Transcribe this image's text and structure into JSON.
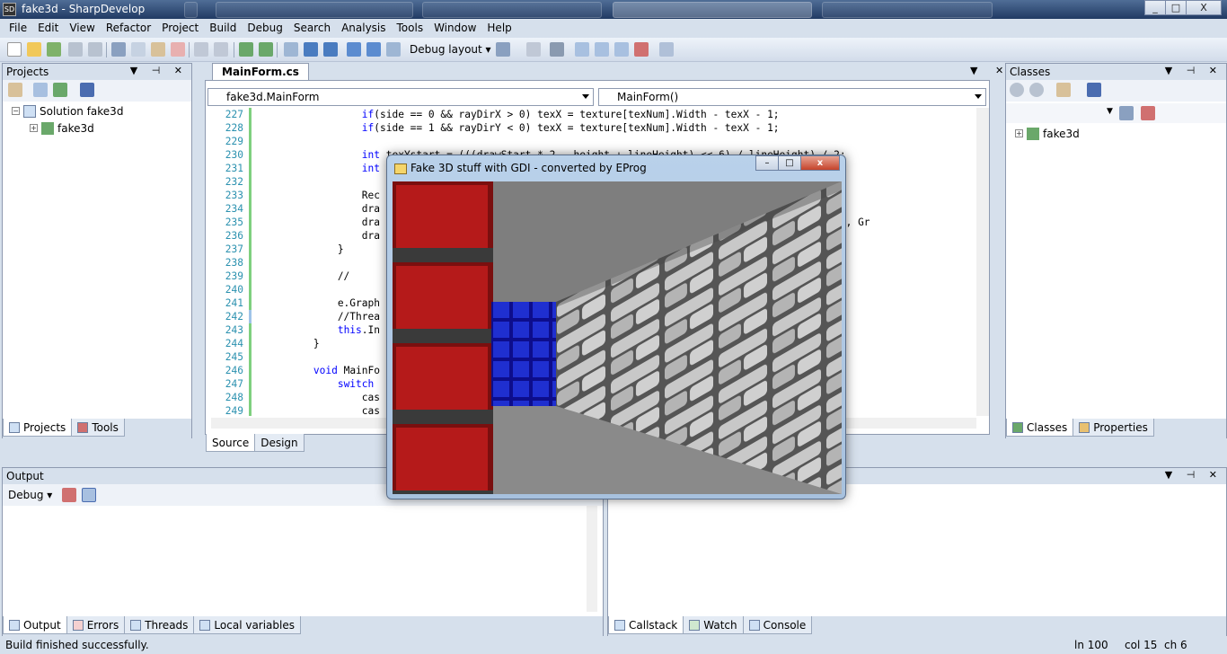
{
  "window": {
    "title": "fake3d - SharpDevelop",
    "controls": [
      "_",
      "□",
      "X"
    ]
  },
  "menu": [
    "File",
    "Edit",
    "View",
    "Refactor",
    "Project",
    "Build",
    "Debug",
    "Search",
    "Analysis",
    "Tools",
    "Window",
    "Help"
  ],
  "toolbar": {
    "layout_dropdown": "Debug layout"
  },
  "projects_pane": {
    "title": "Projects",
    "solution": "Solution fake3d",
    "project": "fake3d",
    "tabs": [
      "Projects",
      "Tools"
    ]
  },
  "editor": {
    "tab": "MainForm.cs",
    "class_combo": "fake3d.MainForm",
    "member_combo": "MainForm()",
    "lines": [
      {
        "n": "227",
        "code": "                if(side == 0 && rayDirX > 0) texX = texture[texNum].Width - texX - 1;"
      },
      {
        "n": "228",
        "code": "                if(side == 1 && rayDirY < 0) texX = texture[texNum].Width - texX - 1;"
      },
      {
        "n": "229",
        "code": ""
      },
      {
        "n": "230",
        "code": "                int texYstart = (((drawStart * 2 - height + lineHeight) << 6) / lineHeight) / 2;"
      },
      {
        "n": "231",
        "code": "                int                                                            neHeight) / 2;"
      },
      {
        "n": "232",
        "code": ""
      },
      {
        "n": "233",
        "code": "                Rec"
      },
      {
        "n": "234",
        "code": "                dra"
      },
      {
        "n": "235",
        "code": "                dra                                                            wStart), cropRect, Gr"
      },
      {
        "n": "236",
        "code": "                dra"
      },
      {
        "n": "237",
        "code": "            }"
      },
      {
        "n": "238",
        "code": ""
      },
      {
        "n": "239",
        "code": "            //"
      },
      {
        "n": "240",
        "code": ""
      },
      {
        "n": "241",
        "code": "            e.Graph"
      },
      {
        "n": "242",
        "code": "            //Threa"
      },
      {
        "n": "243",
        "code": "            this.In"
      },
      {
        "n": "244",
        "code": "        }"
      },
      {
        "n": "245",
        "code": ""
      },
      {
        "n": "246",
        "code": "        void MainFo"
      },
      {
        "n": "247",
        "code": "            switch"
      },
      {
        "n": "248",
        "code": "                cas"
      },
      {
        "n": "249",
        "code": "                cas"
      }
    ],
    "bottom_tabs": [
      "Source",
      "Design"
    ]
  },
  "dialog": {
    "title": "Fake 3D stuff with GDI - converted by EProg",
    "controls": [
      "–",
      "□",
      "x"
    ]
  },
  "classes_pane": {
    "title": "Classes",
    "root": "fake3d",
    "tabs": [
      "Classes",
      "Properties"
    ]
  },
  "output_pane": {
    "title": "Output",
    "dropdown": "Debug",
    "tabs": [
      "Output",
      "Errors",
      "Threads",
      "Local variables"
    ]
  },
  "right_bottom_tabs": [
    "Callstack",
    "Watch",
    "Console"
  ],
  "statusbar": {
    "message": "Build finished successfully.",
    "line": "ln 100",
    "col": "col 15",
    "ch": "ch 6"
  }
}
